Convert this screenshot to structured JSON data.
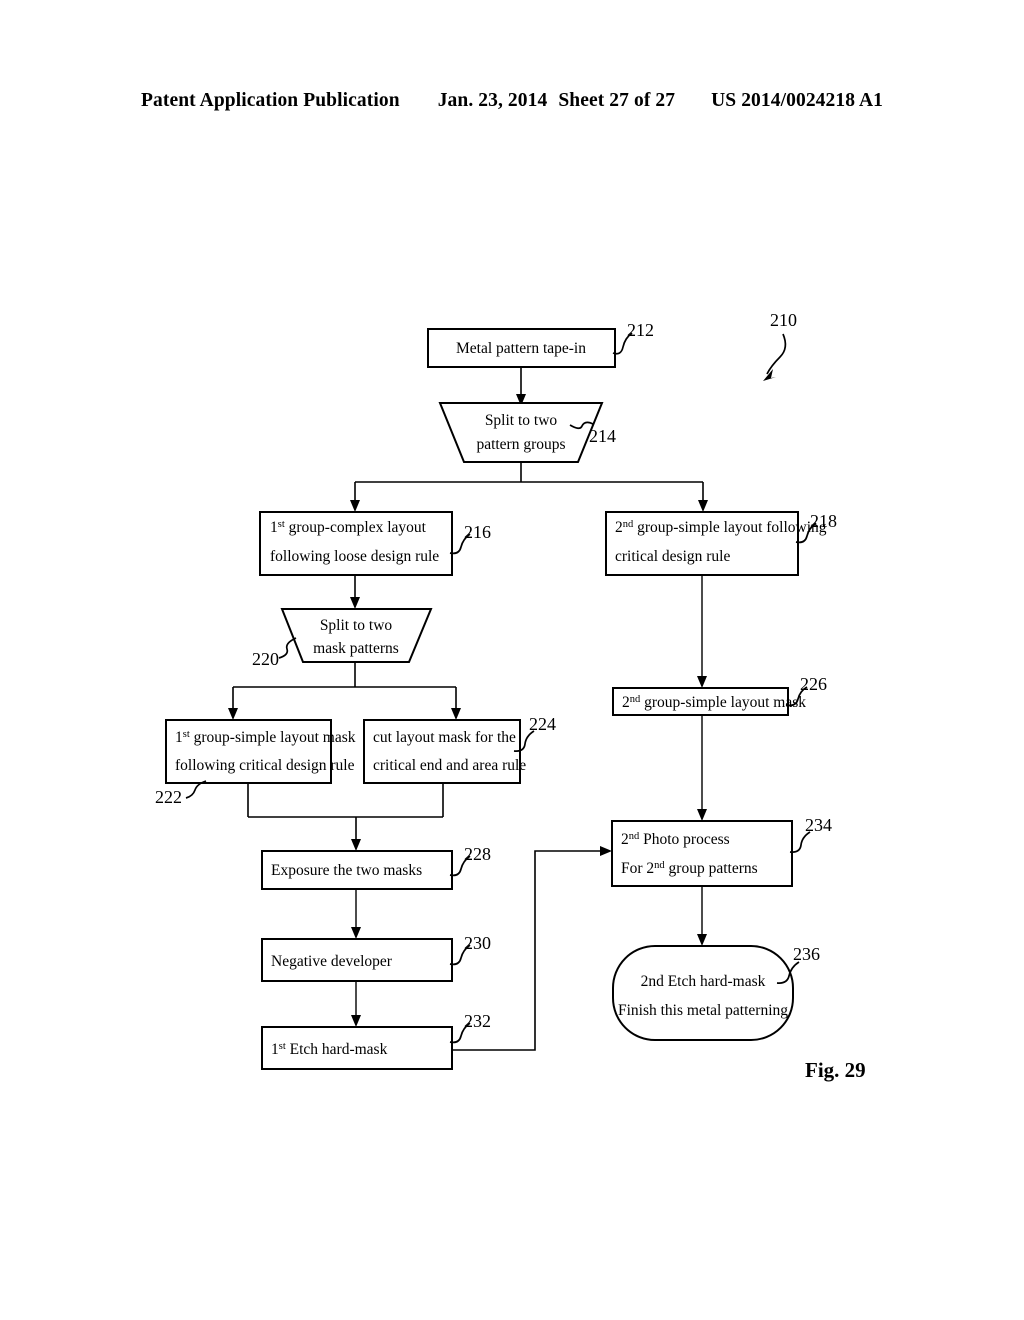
{
  "header": {
    "publication": "Patent Application Publication",
    "date": "Jan. 23, 2014",
    "sheet": "Sheet 27 of 27",
    "patent_number": "US 2014/0024218 A1"
  },
  "figure": {
    "label": "Fig. 29",
    "diagram_ref": "210",
    "nodes": [
      {
        "ref": "212",
        "shape": "rect",
        "lines": [
          "Metal pattern tape-in"
        ]
      },
      {
        "ref": "214",
        "shape": "trapezoid",
        "lines": [
          "Split to two",
          "pattern groups"
        ]
      },
      {
        "ref": "216",
        "shape": "rect",
        "line1_pre": "1",
        "line1_sup": "st",
        "line1_post": " group-complex layout",
        "line2": "following loose design rule"
      },
      {
        "ref": "218",
        "shape": "rect",
        "line1_pre": "2",
        "line1_sup": "nd",
        "line1_post": " group-simple layout following",
        "line2": "critical design rule"
      },
      {
        "ref": "220",
        "shape": "trapezoid",
        "lines": [
          "Split to two",
          "mask patterns"
        ]
      },
      {
        "ref": "222",
        "shape": "rect",
        "line1_pre": "1",
        "line1_sup": "st",
        "line1_post": " group-simple layout mask",
        "line2": "following critical design rule"
      },
      {
        "ref": "224",
        "shape": "rect",
        "line1_pre": "cut layout mask for the",
        "line1_sup": "",
        "line1_post": "",
        "line2": "critical end and area rule"
      },
      {
        "ref": "226",
        "shape": "rect",
        "line1_pre": "2",
        "line1_sup": "nd",
        "line1_post": " group-simple layout mask"
      },
      {
        "ref": "228",
        "shape": "rect",
        "lines": [
          "Exposure the two masks"
        ]
      },
      {
        "ref": "230",
        "shape": "rect",
        "lines": [
          "Negative developer"
        ]
      },
      {
        "ref": "232",
        "shape": "rect",
        "line1_pre": "1",
        "line1_sup": "st",
        "line1_post": " Etch hard-mask"
      },
      {
        "ref": "234",
        "shape": "rect",
        "line1_pre": "2",
        "line1_sup": "nd",
        "line1_post": " Photo process",
        "line2_pre": "For 2",
        "line2_sup": "nd",
        "line2_post": " group patterns"
      },
      {
        "ref": "236",
        "shape": "rounded",
        "lines": [
          "2nd Etch hard-mask",
          "Finish this metal patterning"
        ]
      }
    ]
  }
}
